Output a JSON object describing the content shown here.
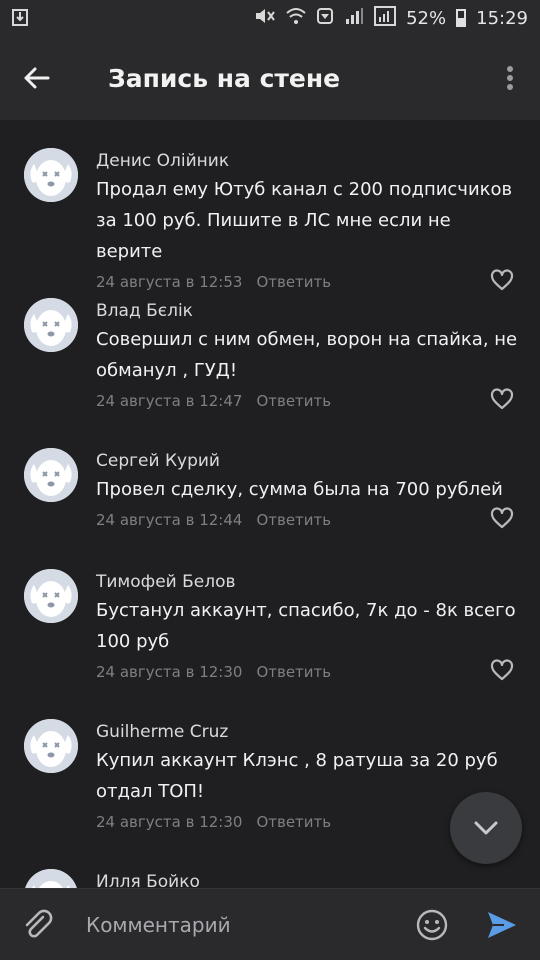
{
  "status_bar": {
    "notification_icon": "download-icon",
    "icons": [
      "mute-icon",
      "wifi-icon",
      "alarm-icon",
      "signal-icon",
      "signal-icon"
    ],
    "battery_percent": "52%",
    "time": "15:29"
  },
  "header": {
    "title": "Запись на стене",
    "back_icon": "arrow-left-icon",
    "menu_icon": "more-vertical-icon"
  },
  "comments": [
    {
      "author": "Денис Олійник",
      "text": "Продал ему Ютуб канал с 200 подписчиков за 100 руб. Пишите в ЛС мне если не верите",
      "date": "24 августа в 12:53",
      "reply_label": "Ответить"
    },
    {
      "author": "Влад Бєлік",
      "text": "Совершил с ним обмен, ворон на спайка, не обманул , ГУД!",
      "date": "24 августа в 12:47",
      "reply_label": "Ответить"
    },
    {
      "author": "Сергей Курий",
      "text": "Провел сделку, сумма была на 700 рублей",
      "date": "24 августа в 12:44",
      "reply_label": "Ответить"
    },
    {
      "author": "Тимофей Белов",
      "text": "Бустанул аккаунт, спасибо, 7к до - 8к всего 100 руб",
      "date": "24 августа в 12:30",
      "reply_label": "Ответить"
    },
    {
      "author": "Guilherme Cruz",
      "text": "Купил аккаунт Клэнс , 8 ратуша за 20 руб отдал ТОП!",
      "date": "24 августа в 12:30",
      "reply_label": "Ответить"
    },
    {
      "author": "Илля Бойко",
      "text": "",
      "date": "",
      "reply_label": ""
    }
  ],
  "composer": {
    "placeholder": "Комментарий",
    "attach_icon": "paperclip-icon",
    "emoji_icon": "smiley-icon",
    "send_icon": "send-icon",
    "scroll_down_icon": "chevron-down-icon"
  },
  "colors": {
    "background": "#1f1f21",
    "bar": "#2a2a2c",
    "accent": "#5a9ce8",
    "muted": "#7d7f84"
  }
}
